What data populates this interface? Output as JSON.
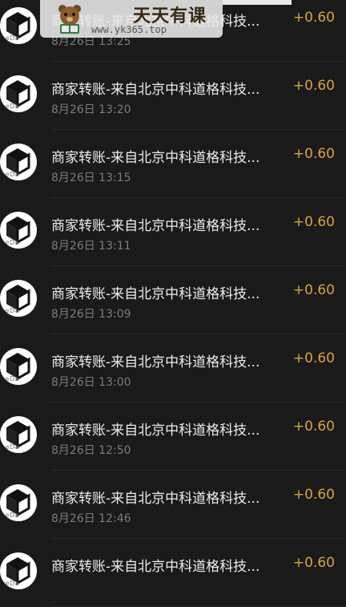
{
  "colors": {
    "background": "#1a1a1a",
    "title": "#ececec",
    "time": "#7b7b7b",
    "amount": "#d8a53a"
  },
  "avatar_icon": "cube-logo-icon",
  "avatar_text": "seDa",
  "watermark": {
    "name": "天天有课",
    "url": "www.yk365.top"
  },
  "transactions": [
    {
      "title": "商家转账-来自北京中科道格科技...",
      "time": "8月26日 13:25",
      "amount": "+0.60"
    },
    {
      "title": "商家转账-来自北京中科道格科技...",
      "time": "8月26日 13:20",
      "amount": "+0.60"
    },
    {
      "title": "商家转账-来自北京中科道格科技...",
      "time": "8月26日 13:15",
      "amount": "+0.60"
    },
    {
      "title": "商家转账-来自北京中科道格科技...",
      "time": "8月26日 13:11",
      "amount": "+0.60"
    },
    {
      "title": "商家转账-来自北京中科道格科技...",
      "time": "8月26日 13:09",
      "amount": "+0.60"
    },
    {
      "title": "商家转账-来自北京中科道格科技...",
      "time": "8月26日 13:00",
      "amount": "+0.60"
    },
    {
      "title": "商家转账-来自北京中科道格科技...",
      "time": "8月26日 12:50",
      "amount": "+0.60"
    },
    {
      "title": "商家转账-来自北京中科道格科技...",
      "time": "8月26日 12:46",
      "amount": "+0.60"
    },
    {
      "title": "商家转账-来自北京中科道格科技...",
      "time": "",
      "amount": "+0.60"
    }
  ]
}
